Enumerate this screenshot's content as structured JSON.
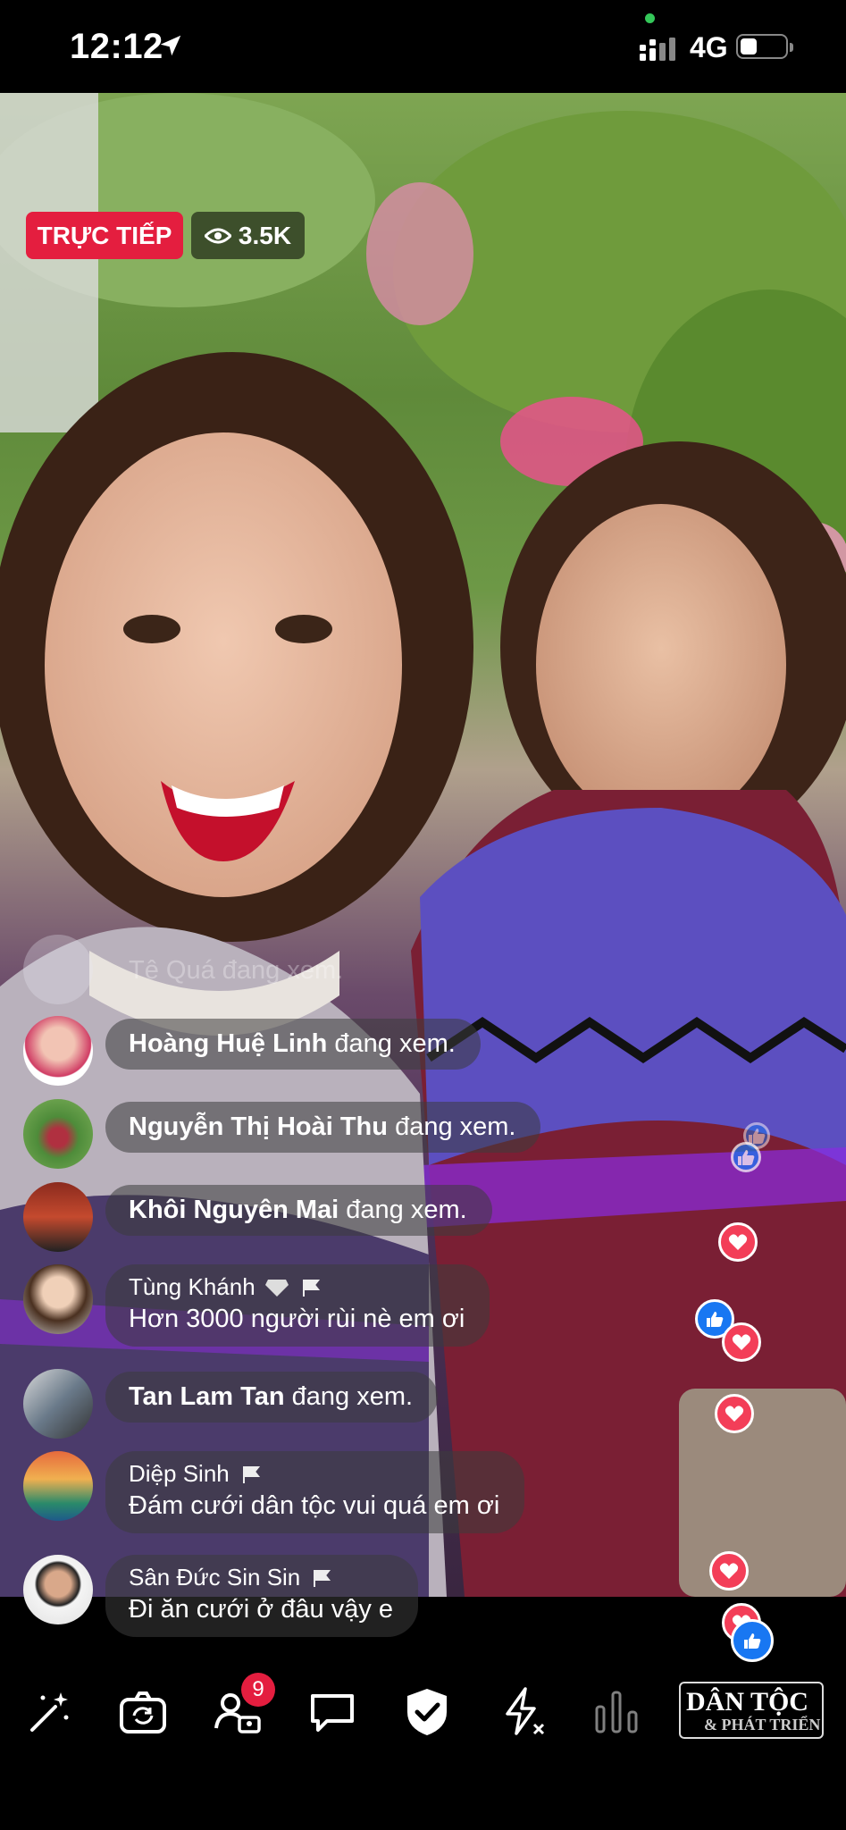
{
  "status_bar": {
    "time": "12:12",
    "network": "4G"
  },
  "live": {
    "label": "TRỰC TIẾP",
    "viewers": "3.5K"
  },
  "comments": [
    {
      "name": "Tê Quá",
      "text": "đang xem.",
      "type": "join"
    },
    {
      "name": "Hoàng Huệ Linh",
      "text": "đang xem.",
      "type": "join"
    },
    {
      "name": "Nguyễn Thị Hoài Thu",
      "text": "đang xem.",
      "type": "join"
    },
    {
      "name": "Khôi Nguyên Mai",
      "text": "đang xem.",
      "type": "join"
    },
    {
      "name": "Tùng Khánh",
      "text": "Hơn 3000 người rùi nè em ơi",
      "type": "comment"
    },
    {
      "name": "Tan Lam Tan",
      "text": "đang xem.",
      "type": "join"
    },
    {
      "name": "Diệp Sinh",
      "text": "Đám cưới dân tộc vui quá em ơi",
      "type": "comment"
    },
    {
      "name": "Sân Đức Sin Sin",
      "text": "Đi ăn cưới ở đâu vậy e",
      "type": "comment"
    }
  ],
  "toolbar": {
    "participants_count": "9"
  },
  "watermark": {
    "line1": "DÂN TỘC",
    "line2": "& PHÁT TRIỂN"
  },
  "colors": {
    "live_red": "#e41e3f",
    "heart": "#f33e58",
    "like": "#1877f2"
  },
  "icons": [
    "magic-wand-icon",
    "flip-camera-icon",
    "participants-icon",
    "comment-icon",
    "shield-check-icon",
    "flash-off-icon",
    "equalizer-icon"
  ]
}
